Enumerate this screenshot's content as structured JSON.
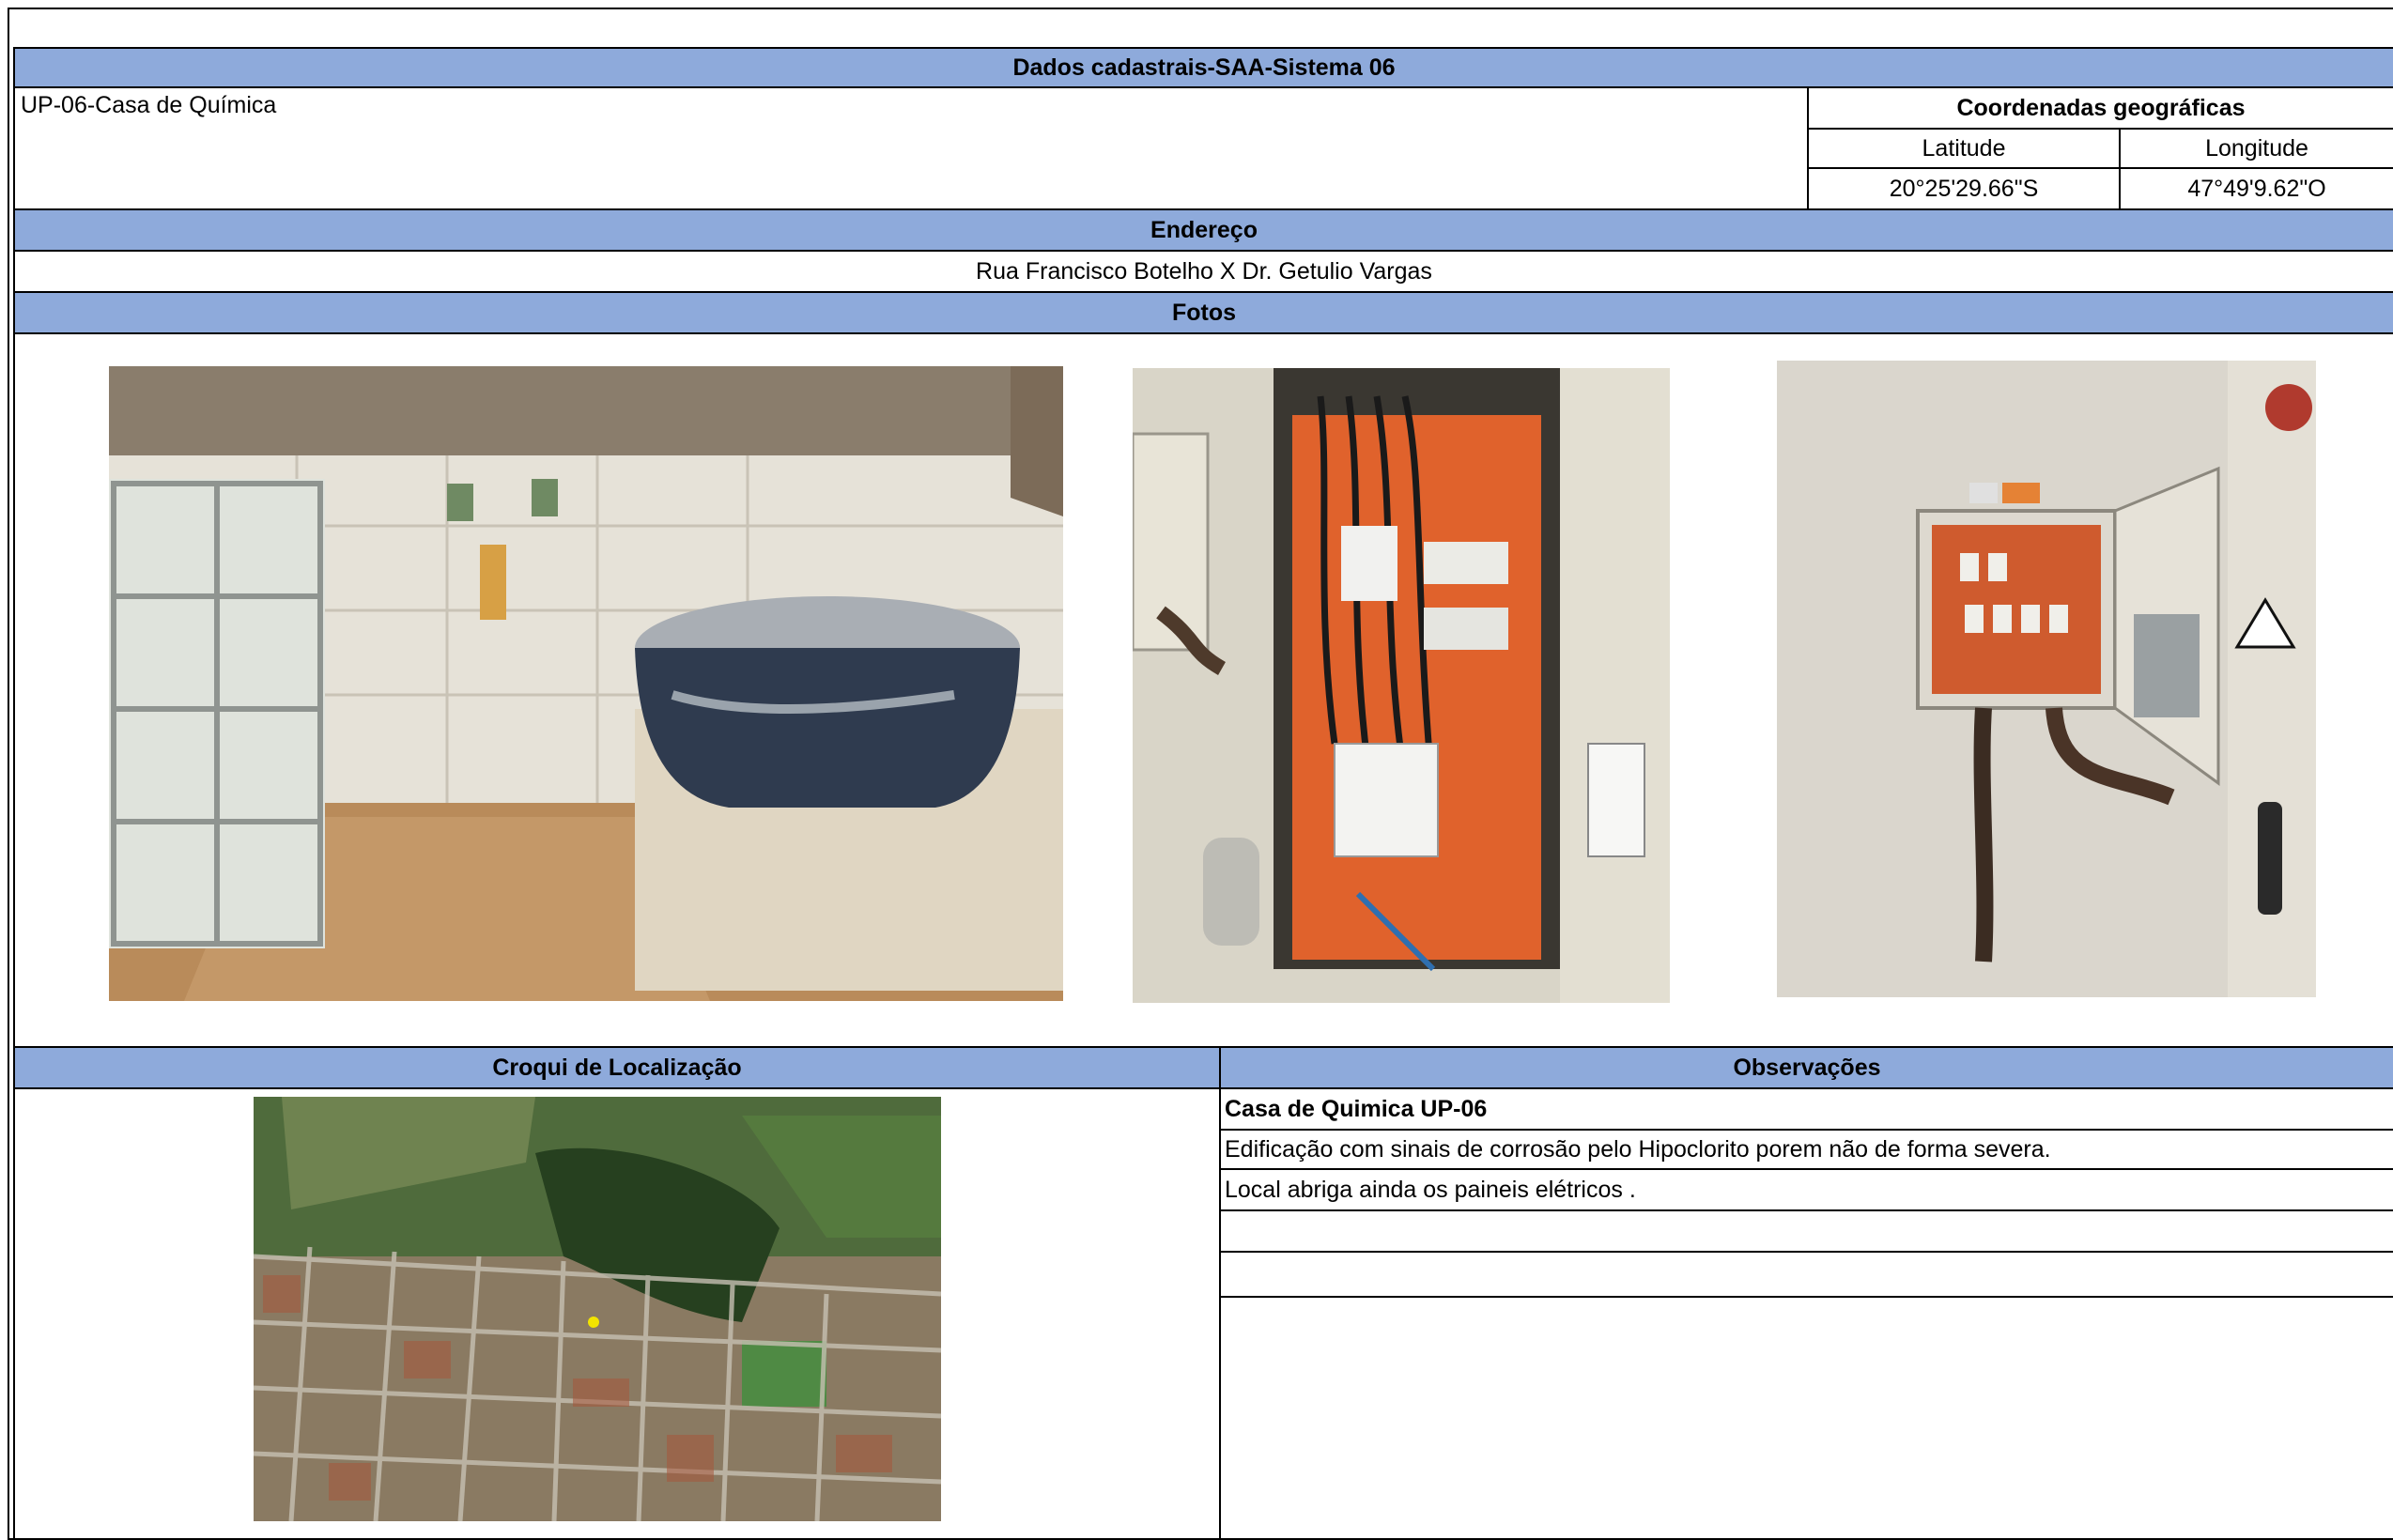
{
  "header": {
    "title": "Dados cadastrais-SAA-Sistema 06"
  },
  "unit": {
    "name": "UP-06-Casa de Química"
  },
  "coordinates": {
    "title": "Coordenadas geográficas",
    "lat_label": "Latitude",
    "lon_label": "Longitude",
    "lat_value": "20°25'29.66\"S",
    "lon_value": "47°49'9.62\"O"
  },
  "address": {
    "title": "Endereço",
    "value": "Rua Francisco Botelho X Dr. Getulio Vargas"
  },
  "photos": {
    "title": "Fotos"
  },
  "croqui": {
    "title": "Croqui de Localização"
  },
  "observations": {
    "title": "Observações",
    "lines": [
      "Casa de Quimica UP-06",
      "Edificação com sinais de corrosão pelo Hipoclorito porem não de forma severa.",
      "Local abriga ainda os paineis elétricos .",
      "",
      ""
    ]
  },
  "colors": {
    "header_band": "#8eaadb",
    "border": "#000000"
  }
}
